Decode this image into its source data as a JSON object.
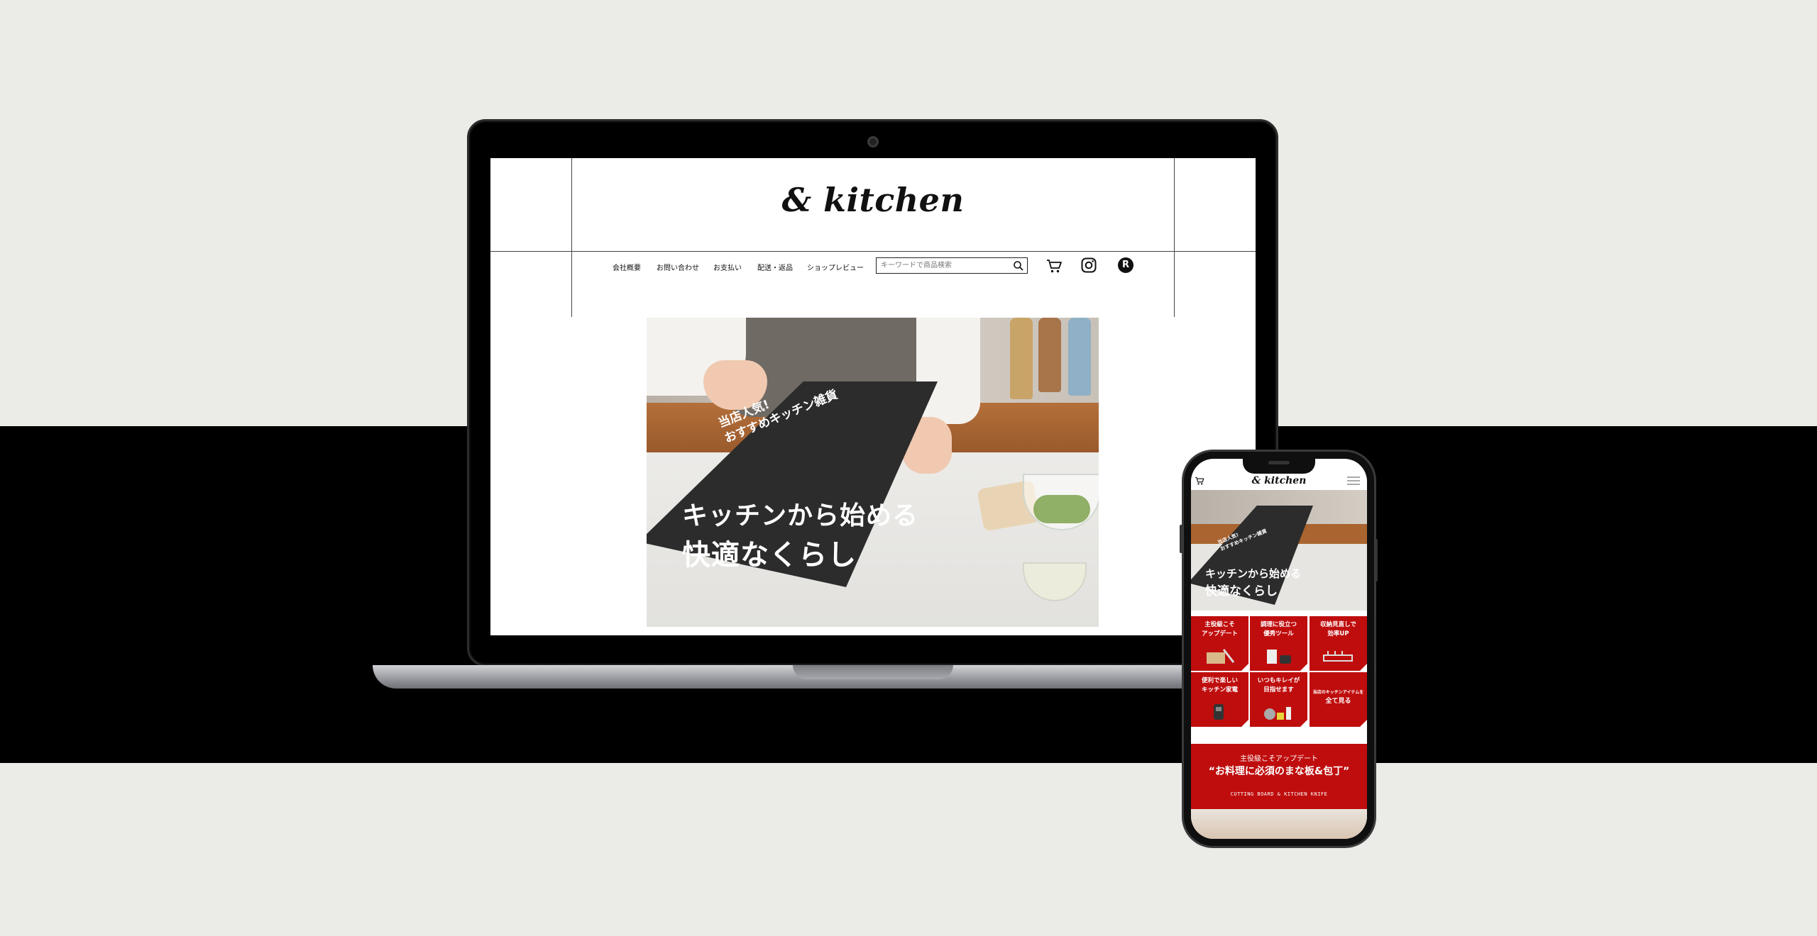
{
  "colors": {
    "background": "#ebebe7",
    "band": "#000000",
    "accent_red": "#bf0d0d",
    "text_dark": "#111111"
  },
  "desktop": {
    "logo": "& kitchen",
    "nav": [
      "会社概要",
      "お問い合わせ",
      "お支払い",
      "配送・返品",
      "ショップレビュー"
    ],
    "search": {
      "placeholder": "キーワードで商品検索"
    },
    "icons": [
      "search-icon",
      "cart-icon",
      "instagram-icon",
      "rakuten-icon"
    ],
    "rakuten_label": "R",
    "hero": {
      "tag_line1": "当店人気!",
      "tag_line2": "おすすめキッチン雑貨",
      "headline1": "キッチンから始める",
      "headline2": "快適なくらし"
    }
  },
  "mobile": {
    "logo": "& kitchen",
    "hero": {
      "tag_line1": "当店人気!",
      "tag_line2": "おすすめキッチン雑貨",
      "headline1": "キッチンから始める",
      "headline2": "快適なくらし"
    },
    "tiles": [
      {
        "line1": "主役級こそ",
        "line2": "アップデート"
      },
      {
        "line1": "調理に役立つ",
        "line2": "優秀ツール"
      },
      {
        "line1": "収納見直しで",
        "line2": "効率UP"
      },
      {
        "line1": "便利で楽しい",
        "line2": "キッチン家電"
      },
      {
        "line1": "いつもキレイが",
        "line2": "目指せます"
      },
      {
        "line1": "当店のキッチンアイテムを",
        "line2": "全て見る"
      }
    ],
    "banner": {
      "subtitle": "主役級こそアップデート",
      "title": "“お料理に必須のまな板&包丁”",
      "english": "CUTTING BOARD & KITCHEN KNIFE"
    }
  }
}
